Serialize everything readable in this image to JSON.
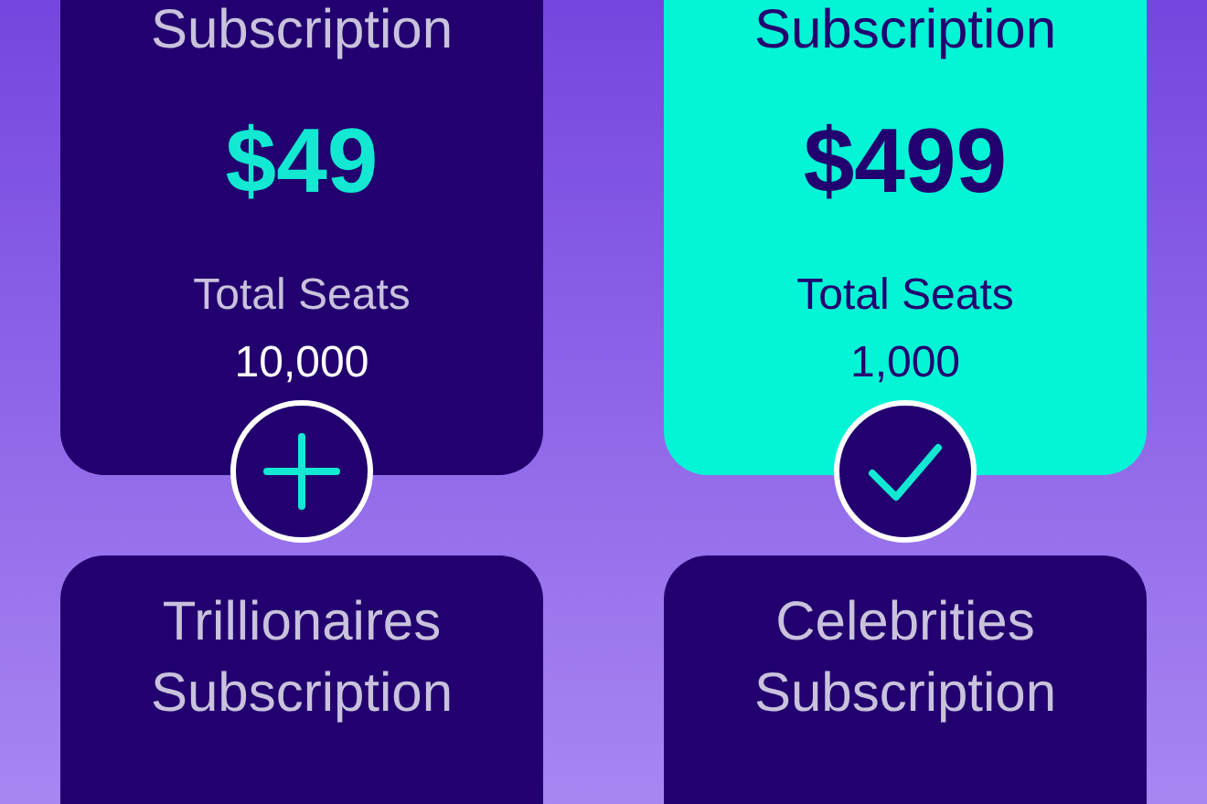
{
  "plans": [
    {
      "title": "Subscription",
      "price": "$49",
      "seats_label": "Total Seats",
      "seats": "10,000",
      "selected": false
    },
    {
      "title": "Subscription",
      "price": "$499",
      "seats_label": "Total Seats",
      "seats": "1,000",
      "selected": true
    },
    {
      "title": "Trillionaires Subscription",
      "selected": false
    },
    {
      "title": "Celebrities Subscription",
      "selected": false
    }
  ]
}
